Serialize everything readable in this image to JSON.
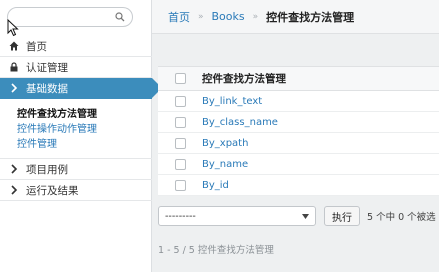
{
  "sidebar": {
    "search": {
      "value": "",
      "placeholder": ""
    },
    "nav": [
      {
        "label": "首页",
        "icon": "home-icon"
      },
      {
        "label": "认证管理",
        "icon": "lock-icon"
      },
      {
        "label": "基础数据",
        "icon": "chevron-right-icon",
        "active": true
      }
    ],
    "subnav": [
      {
        "label": "控件查找方法管理",
        "current": true
      },
      {
        "label": "控件操作动作管理"
      },
      {
        "label": "控件管理"
      }
    ],
    "nav_bottom": [
      {
        "label": "项目用例",
        "icon": "chevron-right-icon"
      },
      {
        "label": "运行及结果",
        "icon": "chevron-right-icon"
      }
    ]
  },
  "breadcrumb": {
    "home": "首页",
    "section": "Books",
    "current": "控件查找方法管理"
  },
  "table": {
    "header": "控件查找方法管理",
    "rows": [
      "By_link_text",
      "By_class_name",
      "By_xpath",
      "By_name",
      "By_id"
    ]
  },
  "actions": {
    "select_value": "---------",
    "run_label": "执行",
    "selected_text": "5 个中 0 个被选"
  },
  "paginator": "1 - 5  /  5 控件查找方法管理",
  "colors": {
    "accent": "#3c8dbc",
    "link": "#2a7ab8"
  }
}
